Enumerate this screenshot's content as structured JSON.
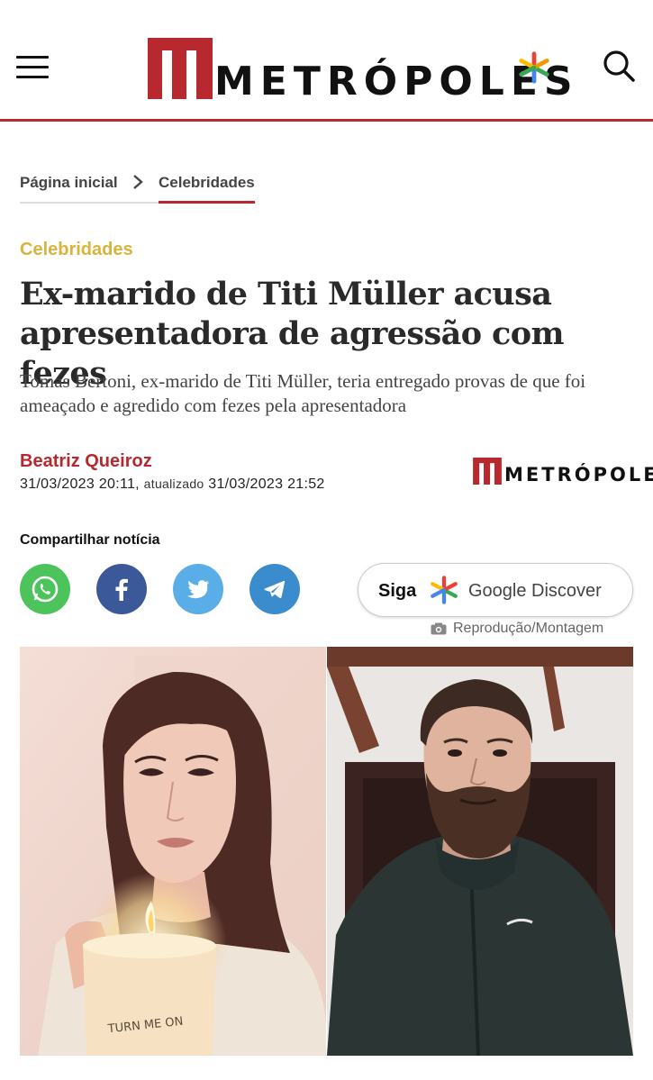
{
  "brand": {
    "name": "METRÓPOLES",
    "accent": "#b8292f"
  },
  "header": {
    "menu_icon": "hamburger-icon",
    "search_icon": "search-icon"
  },
  "breadcrumb": {
    "home": "Página inicial",
    "current": "Celebridades"
  },
  "article": {
    "category": "Celebridades",
    "headline": "Ex-marido de Titi Müller acusa apresentadora de agressão com fezes",
    "subtitle": "Tomás Bertoni, ex-marido de Titi Müller, teria entregado provas de que foi ameaçado e agredido com fezes pela apresentadora",
    "author": "Beatriz Queiroz",
    "published": "31/03/2023 20:11,",
    "updated_label": "atualizado",
    "updated": "31/03/2023 21:52"
  },
  "share": {
    "label": "Compartilhar notícia",
    "buttons": [
      {
        "name": "WhatsApp",
        "icon": "whatsapp-icon",
        "color": "#4cc35b"
      },
      {
        "name": "Facebook",
        "icon": "facebook-icon",
        "color": "#3b5998"
      },
      {
        "name": "Twitter",
        "icon": "twitter-icon",
        "color": "#5aaee8"
      },
      {
        "name": "Telegram",
        "icon": "telegram-icon",
        "color": "#3b8ccc"
      }
    ]
  },
  "discover": {
    "siga": "Siga",
    "text": "Google Discover"
  },
  "image": {
    "credit": "Reprodução/Montagem",
    "candle_text": "TURN ME ON"
  }
}
